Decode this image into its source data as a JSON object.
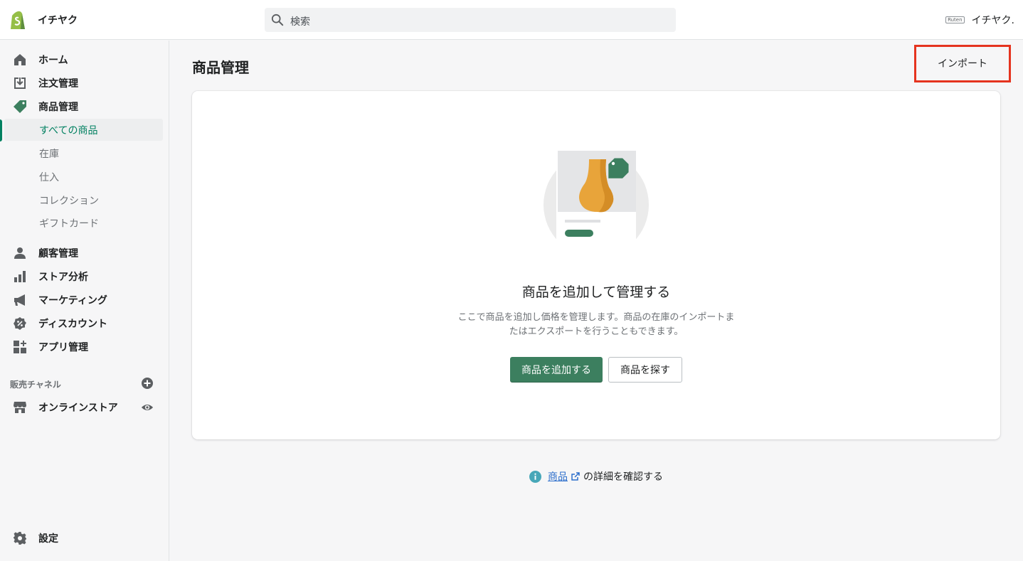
{
  "topbar": {
    "store_name": "イチヤク",
    "search_placeholder": "検索",
    "brand_mini": "Ruten",
    "user_name": "イチヤク."
  },
  "sidebar": {
    "items": [
      {
        "label": "ホーム",
        "icon": "home-icon"
      },
      {
        "label": "注文管理",
        "icon": "orders-icon"
      },
      {
        "label": "商品管理",
        "icon": "tag-icon"
      }
    ],
    "product_subitems": [
      "すべての商品",
      "在庫",
      "仕入",
      "コレクション",
      "ギフトカード"
    ],
    "items2": [
      {
        "label": "顧客管理",
        "icon": "customer-icon"
      },
      {
        "label": "ストア分析",
        "icon": "analytics-icon"
      },
      {
        "label": "マーケティング",
        "icon": "megaphone-icon"
      },
      {
        "label": "ディスカウント",
        "icon": "discount-icon"
      },
      {
        "label": "アプリ管理",
        "icon": "apps-icon"
      }
    ],
    "sales_channels_label": "販売チャネル",
    "online_store": "オンラインストア",
    "settings": "設定"
  },
  "main": {
    "page_title": "商品管理",
    "import_label": "インポート",
    "empty_heading": "商品を追加して管理する",
    "empty_desc": "ここで商品を追加し価格を管理します。商品の在庫のインポートまたはエクスポートを行うこともできます。",
    "primary_label": "商品を追加する",
    "secondary_label": "商品を探す",
    "help_link": "商品",
    "help_suffix": "の詳細を確認する"
  },
  "colors": {
    "accent": "#008060",
    "primary_button": "#3c7f5f",
    "highlight": "#e5341f",
    "link": "#2c6ecb"
  }
}
